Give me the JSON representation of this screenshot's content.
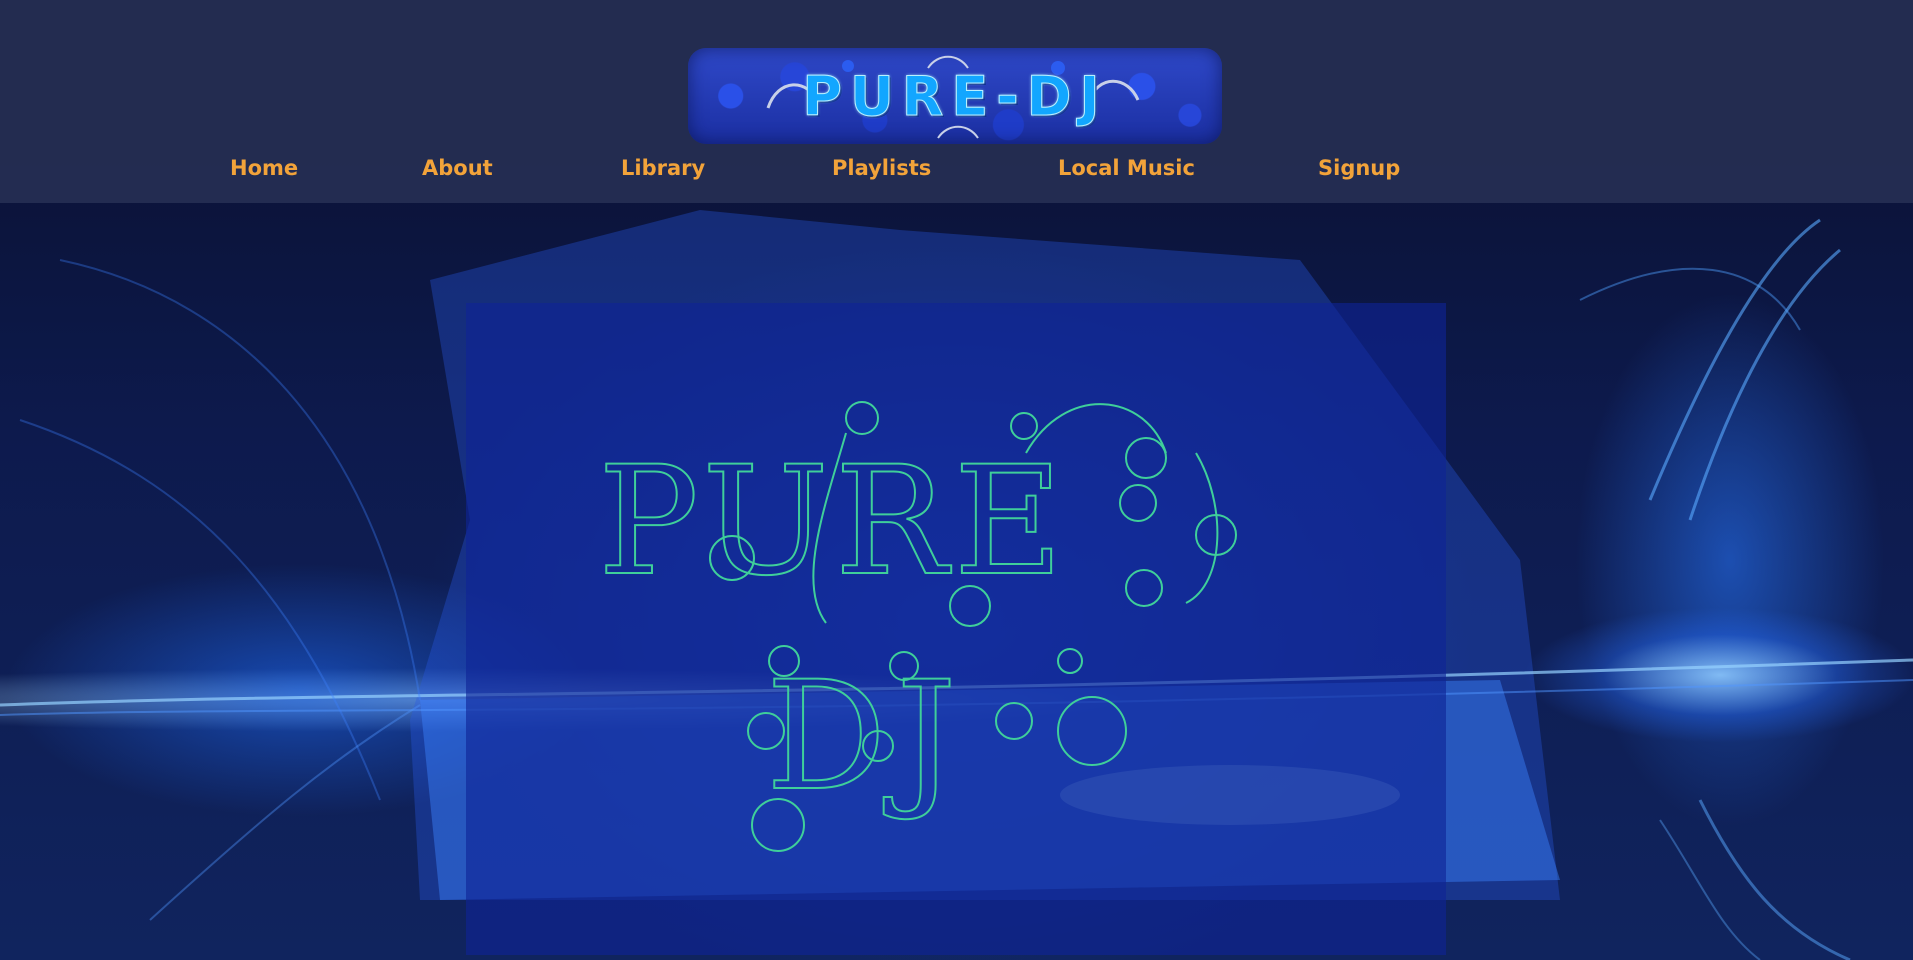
{
  "site": {
    "logo_text": "PURE-DJ"
  },
  "nav": {
    "items": [
      {
        "label": "Home"
      },
      {
        "label": "About"
      },
      {
        "label": "Library"
      },
      {
        "label": "Playlists"
      },
      {
        "label": "Local Music"
      },
      {
        "label": "Signup"
      }
    ]
  },
  "hero": {
    "line1": "PURE",
    "line2": "DJ",
    "color": "#3fcf9a"
  },
  "colors": {
    "header_bg": "#242d52",
    "nav_text": "#f2a33a",
    "logo_text": "#12a6ff",
    "panel_bg": "#0e2496"
  }
}
